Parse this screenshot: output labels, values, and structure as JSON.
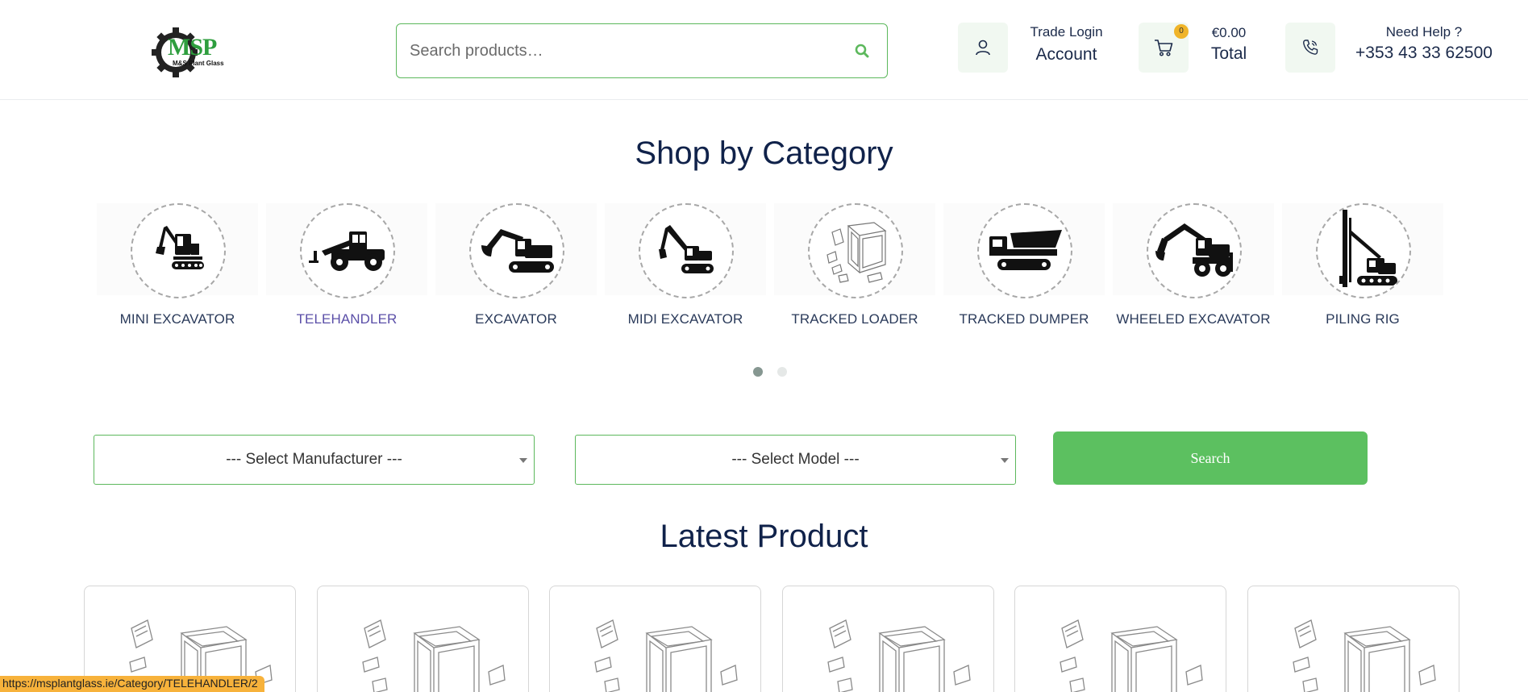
{
  "header": {
    "logo": {
      "text": "MSP",
      "subtext": "M&S Plant Glass",
      "icon": "gear-icon"
    },
    "search": {
      "placeholder": "Search products…",
      "icon": "search-icon"
    },
    "account": {
      "small": "Trade Login",
      "big": "Account",
      "icon": "user-icon"
    },
    "cart": {
      "count": "0",
      "small": "€0.00",
      "big": "Total",
      "icon": "cart-icon"
    },
    "help": {
      "small": "Need Help ?",
      "big": "+353 43 33 62500",
      "icon": "phone-icon"
    }
  },
  "categories_section": {
    "title": "Shop by Category",
    "items": [
      {
        "label": "MINI EXCAVATOR",
        "icon": "mini-excavator-icon"
      },
      {
        "label": "TELEHANDLER",
        "icon": "telehandler-icon"
      },
      {
        "label": "EXCAVATOR",
        "icon": "excavator-icon"
      },
      {
        "label": "MIDI EXCAVATOR",
        "icon": "midi-excavator-icon"
      },
      {
        "label": "TRACKED LOADER",
        "icon": "tracked-loader-icon"
      },
      {
        "label": "TRACKED DUMPER",
        "icon": "tracked-dumper-icon"
      },
      {
        "label": "WHEELED EXCAVATOR",
        "icon": "wheeled-excavator-icon"
      },
      {
        "label": "PILING RIG",
        "icon": "piling-rig-icon"
      }
    ],
    "active_item": "TELEHANDLER",
    "carousel_pages": 2,
    "carousel_active": 1
  },
  "filters": {
    "manufacturer_placeholder": "--- Select Manufacturer ---",
    "model_placeholder": "--- Select Model ---",
    "search_label": "Search"
  },
  "latest_section": {
    "title": "Latest Product",
    "product_count": 6,
    "product_icon": "cab-glass-diagram-icon"
  },
  "status_bar": {
    "url": "https://msplantglass.ie/Category/TELEHANDLER/2"
  },
  "colors": {
    "accent_green": "#5cc060",
    "border_green": "#5cb85c",
    "title_navy": "#10224a",
    "active_purple": "#5b4fa8",
    "badge_yellow": "#f0b429",
    "status_orange": "#f7b23b"
  }
}
